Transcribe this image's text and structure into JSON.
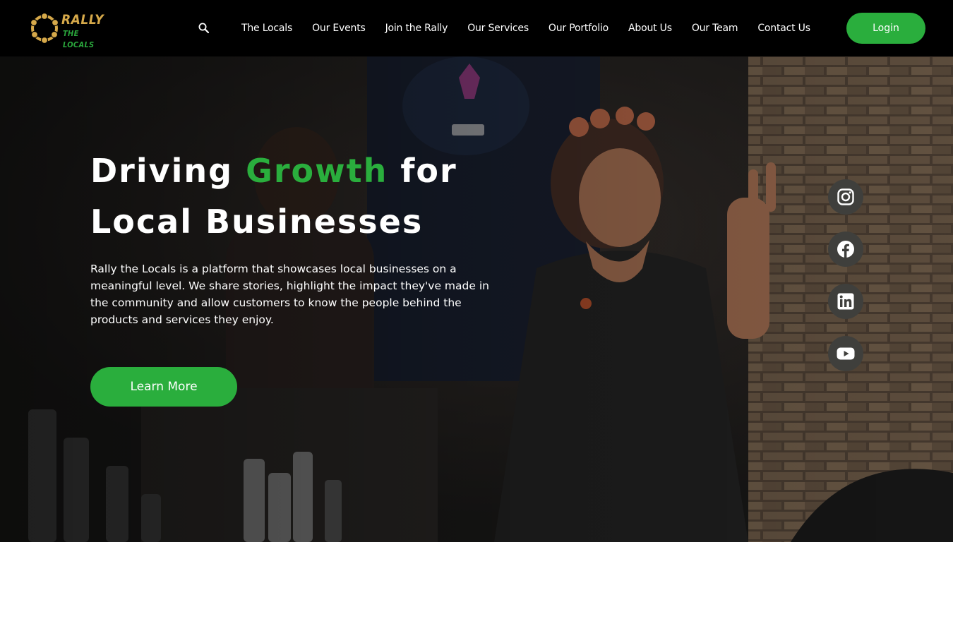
{
  "brand": {
    "logo_line1": "RALLY",
    "logo_line2": "THE LOCALS",
    "gold": "#d6a94a",
    "green": "#2aae3d"
  },
  "header": {
    "search_icon": "search-icon",
    "nav": [
      {
        "label": "The Locals"
      },
      {
        "label": "Our Events"
      },
      {
        "label": "Join the Rally"
      },
      {
        "label": "Our Services"
      },
      {
        "label": "Our Portfolio"
      },
      {
        "label": "About Us"
      },
      {
        "label": "Our Team"
      },
      {
        "label": "Contact Us"
      }
    ],
    "login_label": "Login"
  },
  "hero": {
    "title_pre": "Driving ",
    "title_accent": "Growth",
    "title_post": " for Local Businesses",
    "description": "Rally the Locals is a platform that showcases local businesses on a meaningful level. We share stories, highlight the impact they've made in the community and allow customers to know the people behind the products and services they enjoy.",
    "cta_label": "Learn More"
  },
  "social": [
    {
      "icon": "instagram-icon"
    },
    {
      "icon": "facebook-icon"
    },
    {
      "icon": "linkedin-icon"
    },
    {
      "icon": "youtube-icon"
    }
  ]
}
